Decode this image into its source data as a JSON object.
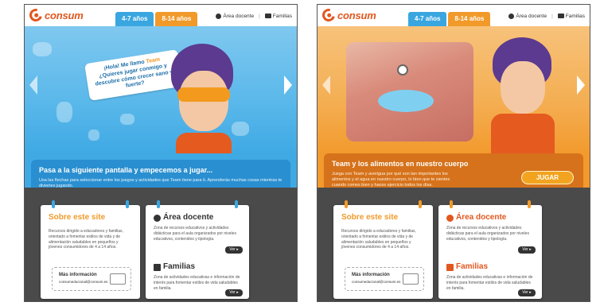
{
  "screens": [
    {
      "brand": "consum",
      "tabs": [
        {
          "label": "4-7 años"
        },
        {
          "label": "8-14 años"
        }
      ],
      "toplinks": {
        "docente": "Área docente",
        "familias": "Familias"
      },
      "bubble": {
        "greeting": "¡Hola! Me llamo ",
        "name": "Team",
        "question": "¿Quieres jugar conmigo y descubre cómo crecer sano y fuerte?"
      },
      "caption": {
        "title": "Pasa a la siguiente pantalla y empecemos a jugar...",
        "text": "Usa las flechas para seleccionar entre los juegos y actividades que Team tiene para ti. Aprenderás muchas cosas mientras te diviertes jugando."
      },
      "sobre": {
        "title": "Sobre este site",
        "text": "Recursos dirigido a educadores y familias, orientado a fomentar estilos de vida y de alimentación saludables en pequeños y jóvenes consumidores de 4 a 14 años.",
        "mas_title": "Más información",
        "mas_mail": "consumeducional@consum.es"
      },
      "area": {
        "title": "Área docente",
        "text": "Zona de recursos educativos y actividades didácticas para el aula organizados por niveles educativos, contenidos y tipología.",
        "ver": "Ver ▸"
      },
      "familias": {
        "title": "Familias",
        "text": "Zona de actividades educativas e información de interés para fomentar estilos de vida saludables en familia.",
        "ver": "Ver ▸"
      }
    },
    {
      "brand": "consum",
      "tabs": [
        {
          "label": "4-7 años"
        },
        {
          "label": "8-14 años"
        }
      ],
      "toplinks": {
        "docente": "Área docente",
        "familias": "Familias"
      },
      "caption": {
        "title": "Team y los alimentos en nuestro cuerpo",
        "text": "Juega con Team y averigua por qué son tan importantes los alimentos y el agua en nuestro cuerpo, lo bien que te sientes cuando comes bien y haces ejercicio todos los días.",
        "button": "JUGAR"
      },
      "sobre": {
        "title": "Sobre este site",
        "text": "Recursos dirigido a educadores y familias, orientado a fomentar estilos de vida y de alimentación saludables en pequeños y jóvenes consumidores de 4 a 14 años.",
        "mas_title": "Más información",
        "mas_mail": "consumeducional@consum.es"
      },
      "area": {
        "title": "Área docente",
        "text": "Zona de recursos educativos y actividades didácticas para el aula organizados por niveles educativos, contenidos y tipología.",
        "ver": "Ver ▸"
      },
      "familias": {
        "title": "Familias",
        "text": "Zona de actividades educativas e información de interés para fomentar estilos de vida saludables en familia.",
        "ver": "Ver ▸"
      }
    }
  ]
}
